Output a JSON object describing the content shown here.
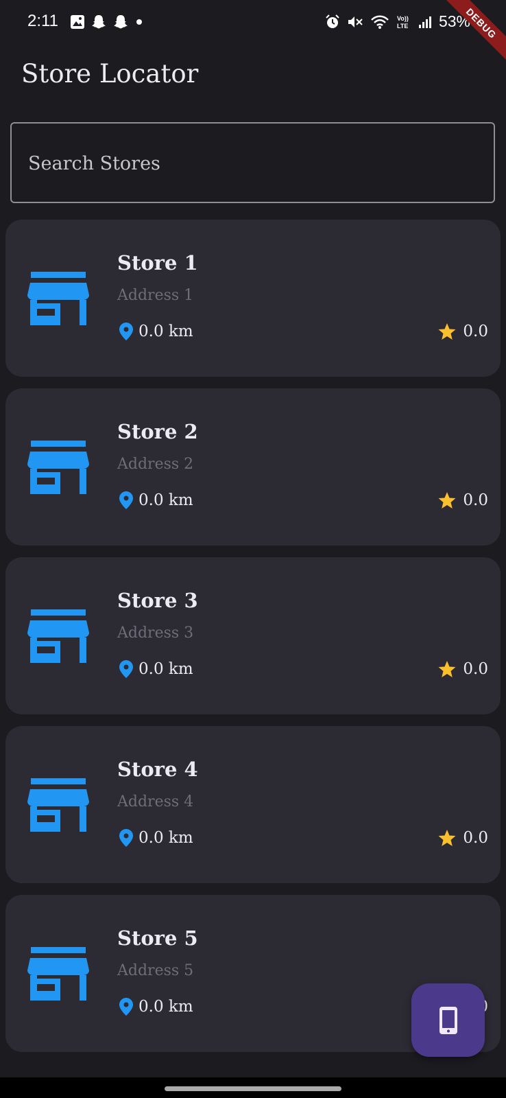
{
  "status_bar": {
    "time": "2:11",
    "battery": "53%",
    "debug_label": "DEBUG"
  },
  "app": {
    "title": "Store Locator"
  },
  "search": {
    "placeholder": "Search Stores"
  },
  "stores": [
    {
      "name": "Store 1",
      "address": "Address 1",
      "distance": "0.0 km",
      "rating": "0.0"
    },
    {
      "name": "Store 2",
      "address": "Address 2",
      "distance": "0.0 km",
      "rating": "0.0"
    },
    {
      "name": "Store 3",
      "address": "Address 3",
      "distance": "0.0 km",
      "rating": "0.0"
    },
    {
      "name": "Store 4",
      "address": "Address 4",
      "distance": "0.0 km",
      "rating": "0.0"
    },
    {
      "name": "Store 5",
      "address": "Address 5",
      "distance": "0.0 km",
      "rating": "0.0"
    }
  ],
  "icons": {
    "store": "storefront-icon",
    "location": "location-pin-icon",
    "rating": "star-icon",
    "fab": "smartphone-icon"
  },
  "colors": {
    "background": "#1c1b20",
    "card": "#2c2a33",
    "accent_blue": "#2196f3",
    "star": "#fbc02d",
    "fab": "#4b3a8c",
    "debug_ribbon": "#8d1c1c"
  }
}
